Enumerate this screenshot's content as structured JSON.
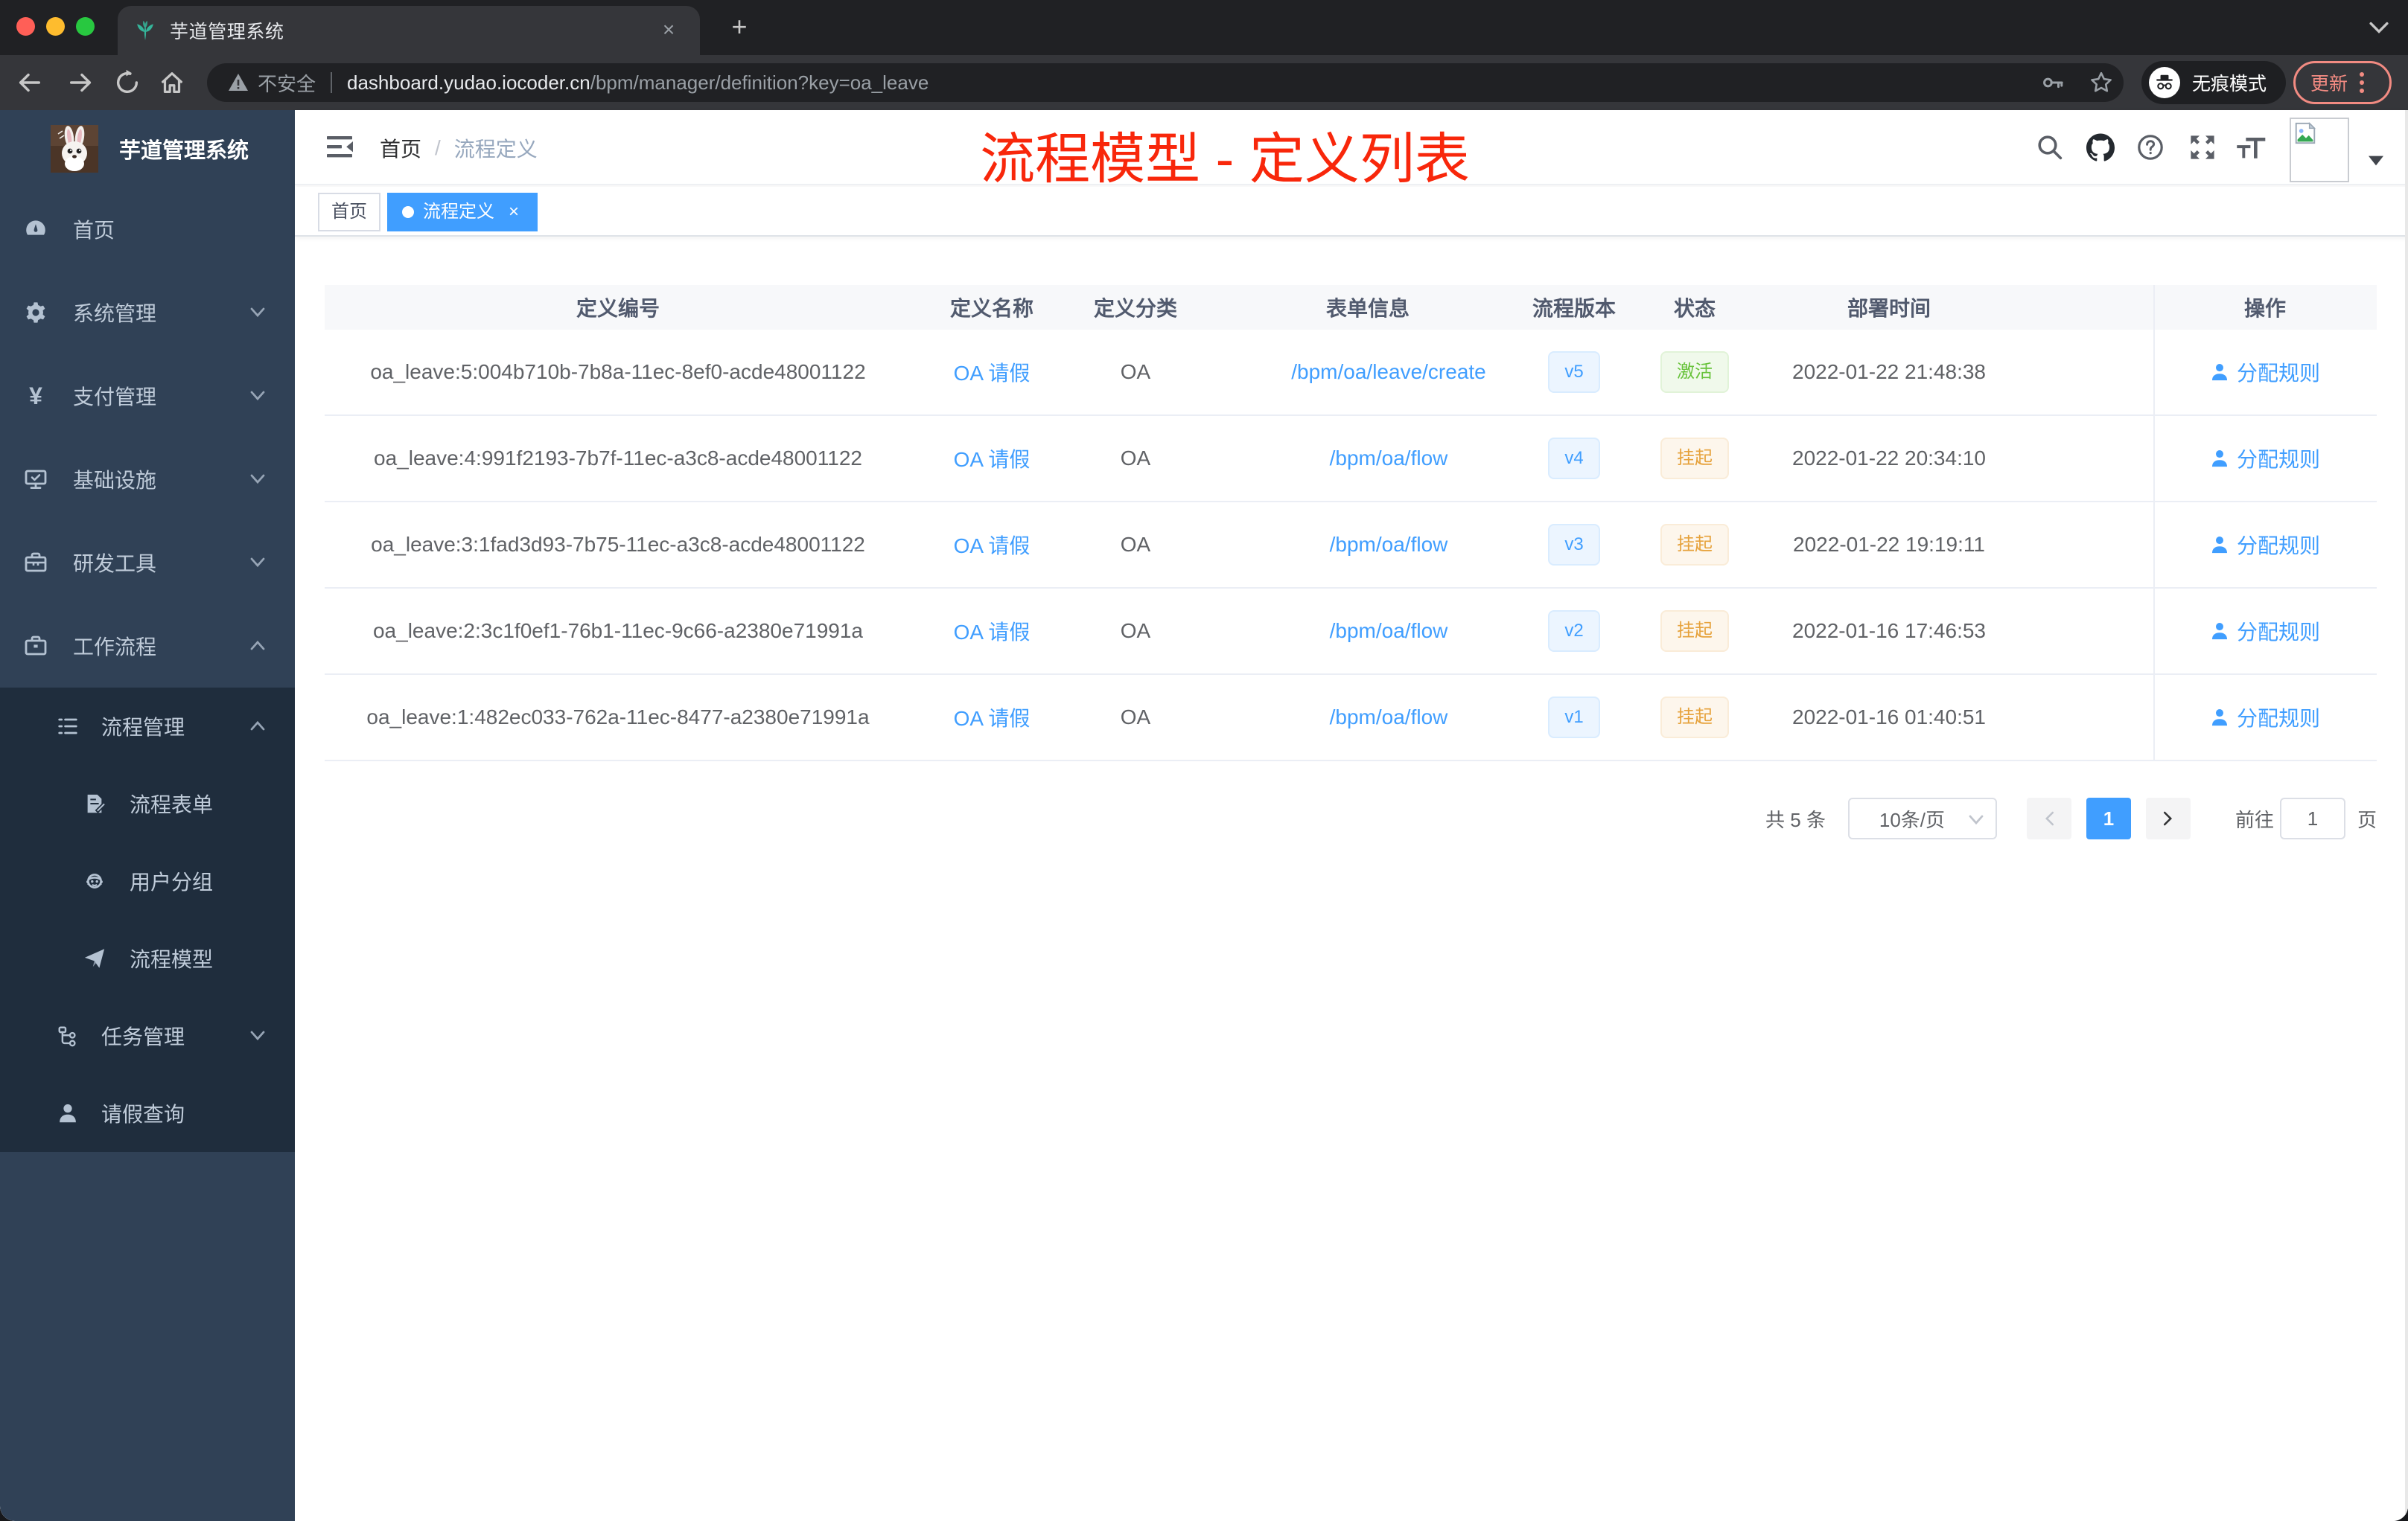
{
  "browser": {
    "tab_title": "芋道管理系统",
    "url_security_label": "不安全",
    "url_host": "dashboard.yudao.iocoder.cn",
    "url_path": "/bpm/manager/definition?key=oa_leave",
    "incognito_label": "无痕模式",
    "update_label": "更新"
  },
  "sidebar": {
    "logo_title": "芋道管理系统",
    "items": [
      {
        "label": "首页"
      },
      {
        "label": "系统管理"
      },
      {
        "label": "支付管理"
      },
      {
        "label": "基础设施"
      },
      {
        "label": "研发工具"
      },
      {
        "label": "工作流程"
      }
    ],
    "workflow_children": {
      "process_manage": {
        "label": "流程管理"
      },
      "process_form": {
        "label": "流程表单"
      },
      "user_group": {
        "label": "用户分组"
      },
      "process_model": {
        "label": "流程模型"
      },
      "task_manage": {
        "label": "任务管理"
      },
      "leave_query": {
        "label": "请假查询"
      }
    }
  },
  "navbar": {
    "breadcrumb": {
      "home": "首页",
      "separator": "/",
      "current": "流程定义"
    }
  },
  "tags": {
    "home": "首页",
    "active": "流程定义"
  },
  "annotation": "流程模型 - 定义列表",
  "table": {
    "columns": [
      "定义编号",
      "定义名称",
      "定义分类",
      "表单信息",
      "流程版本",
      "状态",
      "部署时间",
      "",
      "操作"
    ],
    "action_label": "分配规则",
    "rows": [
      {
        "id": "oa_leave:5:004b710b-7b8a-11ec-8ef0-acde48001122",
        "name": "OA 请假",
        "category": "OA",
        "form": "/bpm/oa/leave/create",
        "version": "v5",
        "status": "激活",
        "status_type": "success",
        "time": "2022-01-22 21:48:38",
        "action": "分配规则"
      },
      {
        "id": "oa_leave:4:991f2193-7b7f-11ec-a3c8-acde48001122",
        "name": "OA 请假",
        "category": "OA",
        "form": "/bpm/oa/flow",
        "version": "v4",
        "status": "挂起",
        "status_type": "warning",
        "time": "2022-01-22 20:34:10",
        "action": "分配规则"
      },
      {
        "id": "oa_leave:3:1fad3d93-7b75-11ec-a3c8-acde48001122",
        "name": "OA 请假",
        "category": "OA",
        "form": "/bpm/oa/flow",
        "version": "v3",
        "status": "挂起",
        "status_type": "warning",
        "time": "2022-01-22 19:19:11",
        "action": "分配规则"
      },
      {
        "id": "oa_leave:2:3c1f0ef1-76b1-11ec-9c66-a2380e71991a",
        "name": "OA 请假",
        "category": "OA",
        "form": "/bpm/oa/flow",
        "version": "v2",
        "status": "挂起",
        "status_type": "warning",
        "time": "2022-01-16 17:46:53",
        "action": "分配规则"
      },
      {
        "id": "oa_leave:1:482ec033-762a-11ec-8477-a2380e71991a",
        "name": "OA 请假",
        "category": "OA",
        "form": "/bpm/oa/flow",
        "version": "v1",
        "status": "挂起",
        "status_type": "warning",
        "time": "2022-01-16 01:40:51",
        "action": "分配规则"
      }
    ]
  },
  "pagination": {
    "total": "共 5 条",
    "page_size": "10条/页",
    "current_page": "1",
    "goto_label": "前往",
    "goto_value": "1",
    "unit_label": "页"
  },
  "colors": {
    "accent_blue": "#409eff",
    "success_green": "#67c23a",
    "warning_orange": "#e6a23c",
    "sidebar_bg": "#304156",
    "submenu_bg": "#1f2d3d",
    "annotation_red": "#f8270b"
  }
}
